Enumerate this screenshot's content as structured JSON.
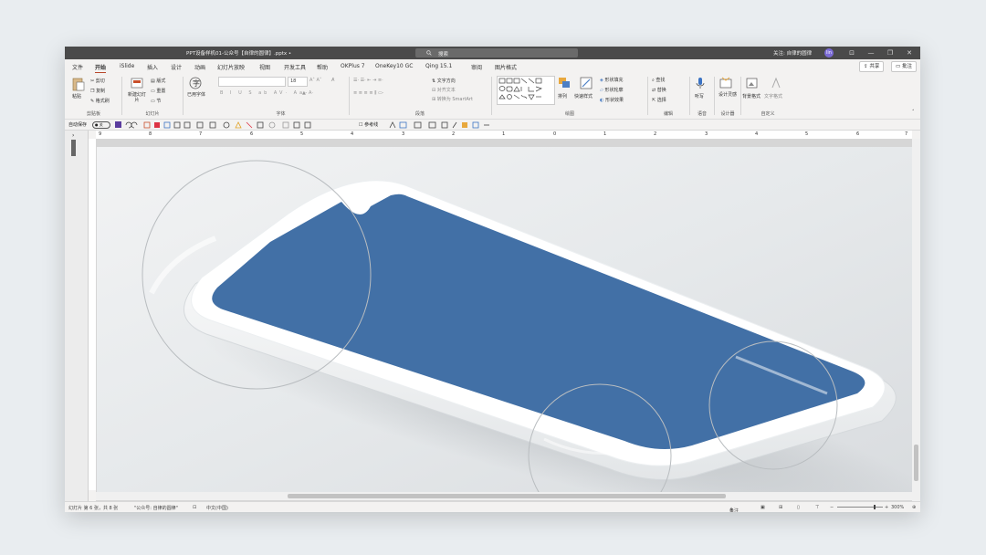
{
  "window": {
    "doc_title": "PPT设备样机01-公众号【自律的圆律】.pptx •",
    "search": "搜索",
    "follow": "关注: 自律的圆律",
    "avatar": "lin",
    "controls": [
      "⊡",
      "—",
      "❐",
      "✕"
    ]
  },
  "menu": {
    "tabs": [
      "文件",
      "开始",
      "iSlide",
      "插入",
      "设计",
      "动画",
      "幻灯片放映",
      "视图",
      "开发工具",
      "帮助",
      "OKPlus 7",
      "OneKey10 GC",
      "Qing 15.1",
      "审阅",
      "图片格式"
    ],
    "active": "开始",
    "share": "共享",
    "comment": "批注"
  },
  "ribbon": {
    "clipboard": {
      "paste": "粘贴",
      "cut": "剪切",
      "copy": "复制",
      "format_painter": "格式刷",
      "label": "剪贴板"
    },
    "slides": {
      "new_slide": "新建幻灯片",
      "layout": "版式",
      "reset": "重置",
      "section": "节",
      "label": "幻灯片"
    },
    "reuse": {
      "text": "已用字体"
    },
    "font": {
      "size": "18",
      "label": "字体"
    },
    "paragraph": {
      "text_dir": "文字方向",
      "align_text": "对齐文本",
      "smartart": "转换为 SmartArt",
      "label": "段落"
    },
    "drawing": {
      "arrange": "排列",
      "quick_styles": "快速样式",
      "fill": "形状填充",
      "outline": "形状轮廓",
      "effects": "形状效果",
      "label": "绘图"
    },
    "editing": {
      "find": "查找",
      "replace": "替换",
      "select": "选择",
      "label": "编辑"
    },
    "voice": {
      "dictate": "听写",
      "label": "语音"
    },
    "designer": {
      "ideas": "设计灵感",
      "label": "设计器"
    },
    "custom": {
      "bg_format": "背景格式",
      "text_format": "文字格式",
      "label": "自定义"
    }
  },
  "qat": {
    "autosave": "自动保存",
    "autosave_state": "关",
    "ref_lines": "参考线"
  },
  "ruler": {
    "ticks": [
      "9",
      "8",
      "7",
      "6",
      "5",
      "4",
      "3",
      "2",
      "1",
      "0",
      "1",
      "2",
      "3",
      "4",
      "5",
      "6",
      "7"
    ]
  },
  "status": {
    "slide": "幻灯片 第 6 张，共 8 张",
    "theme": "\"公众号: 自律的圆律\"",
    "lang": "中文(中国)",
    "notes": "备注",
    "zoom": "300%"
  },
  "colors": {
    "screen": "#4270a6",
    "body": "#ffffff",
    "accent": "#b7472a",
    "titlebar": "#4a4a4a"
  }
}
